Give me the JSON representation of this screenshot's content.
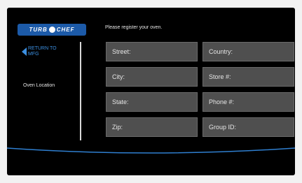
{
  "logo": {
    "pre": "TURB",
    "post": "CHEF"
  },
  "nav": {
    "back_line1": "RETURN TO",
    "back_line2": "MFG"
  },
  "sidebar": {
    "location_label": "Oven Location"
  },
  "form": {
    "prompt": "Please register your oven.",
    "fields": [
      {
        "label": "Street:"
      },
      {
        "label": "Country:"
      },
      {
        "label": "City:"
      },
      {
        "label": "Store #:"
      },
      {
        "label": "State:"
      },
      {
        "label": "Phone #:"
      },
      {
        "label": "Zip:"
      },
      {
        "label": "Group ID:"
      }
    ]
  },
  "colors": {
    "background": "#000000",
    "field_fill": "#4f4f4f",
    "accent_blue": "#3c8fe0",
    "logo_blue": "#1c5aa8"
  }
}
